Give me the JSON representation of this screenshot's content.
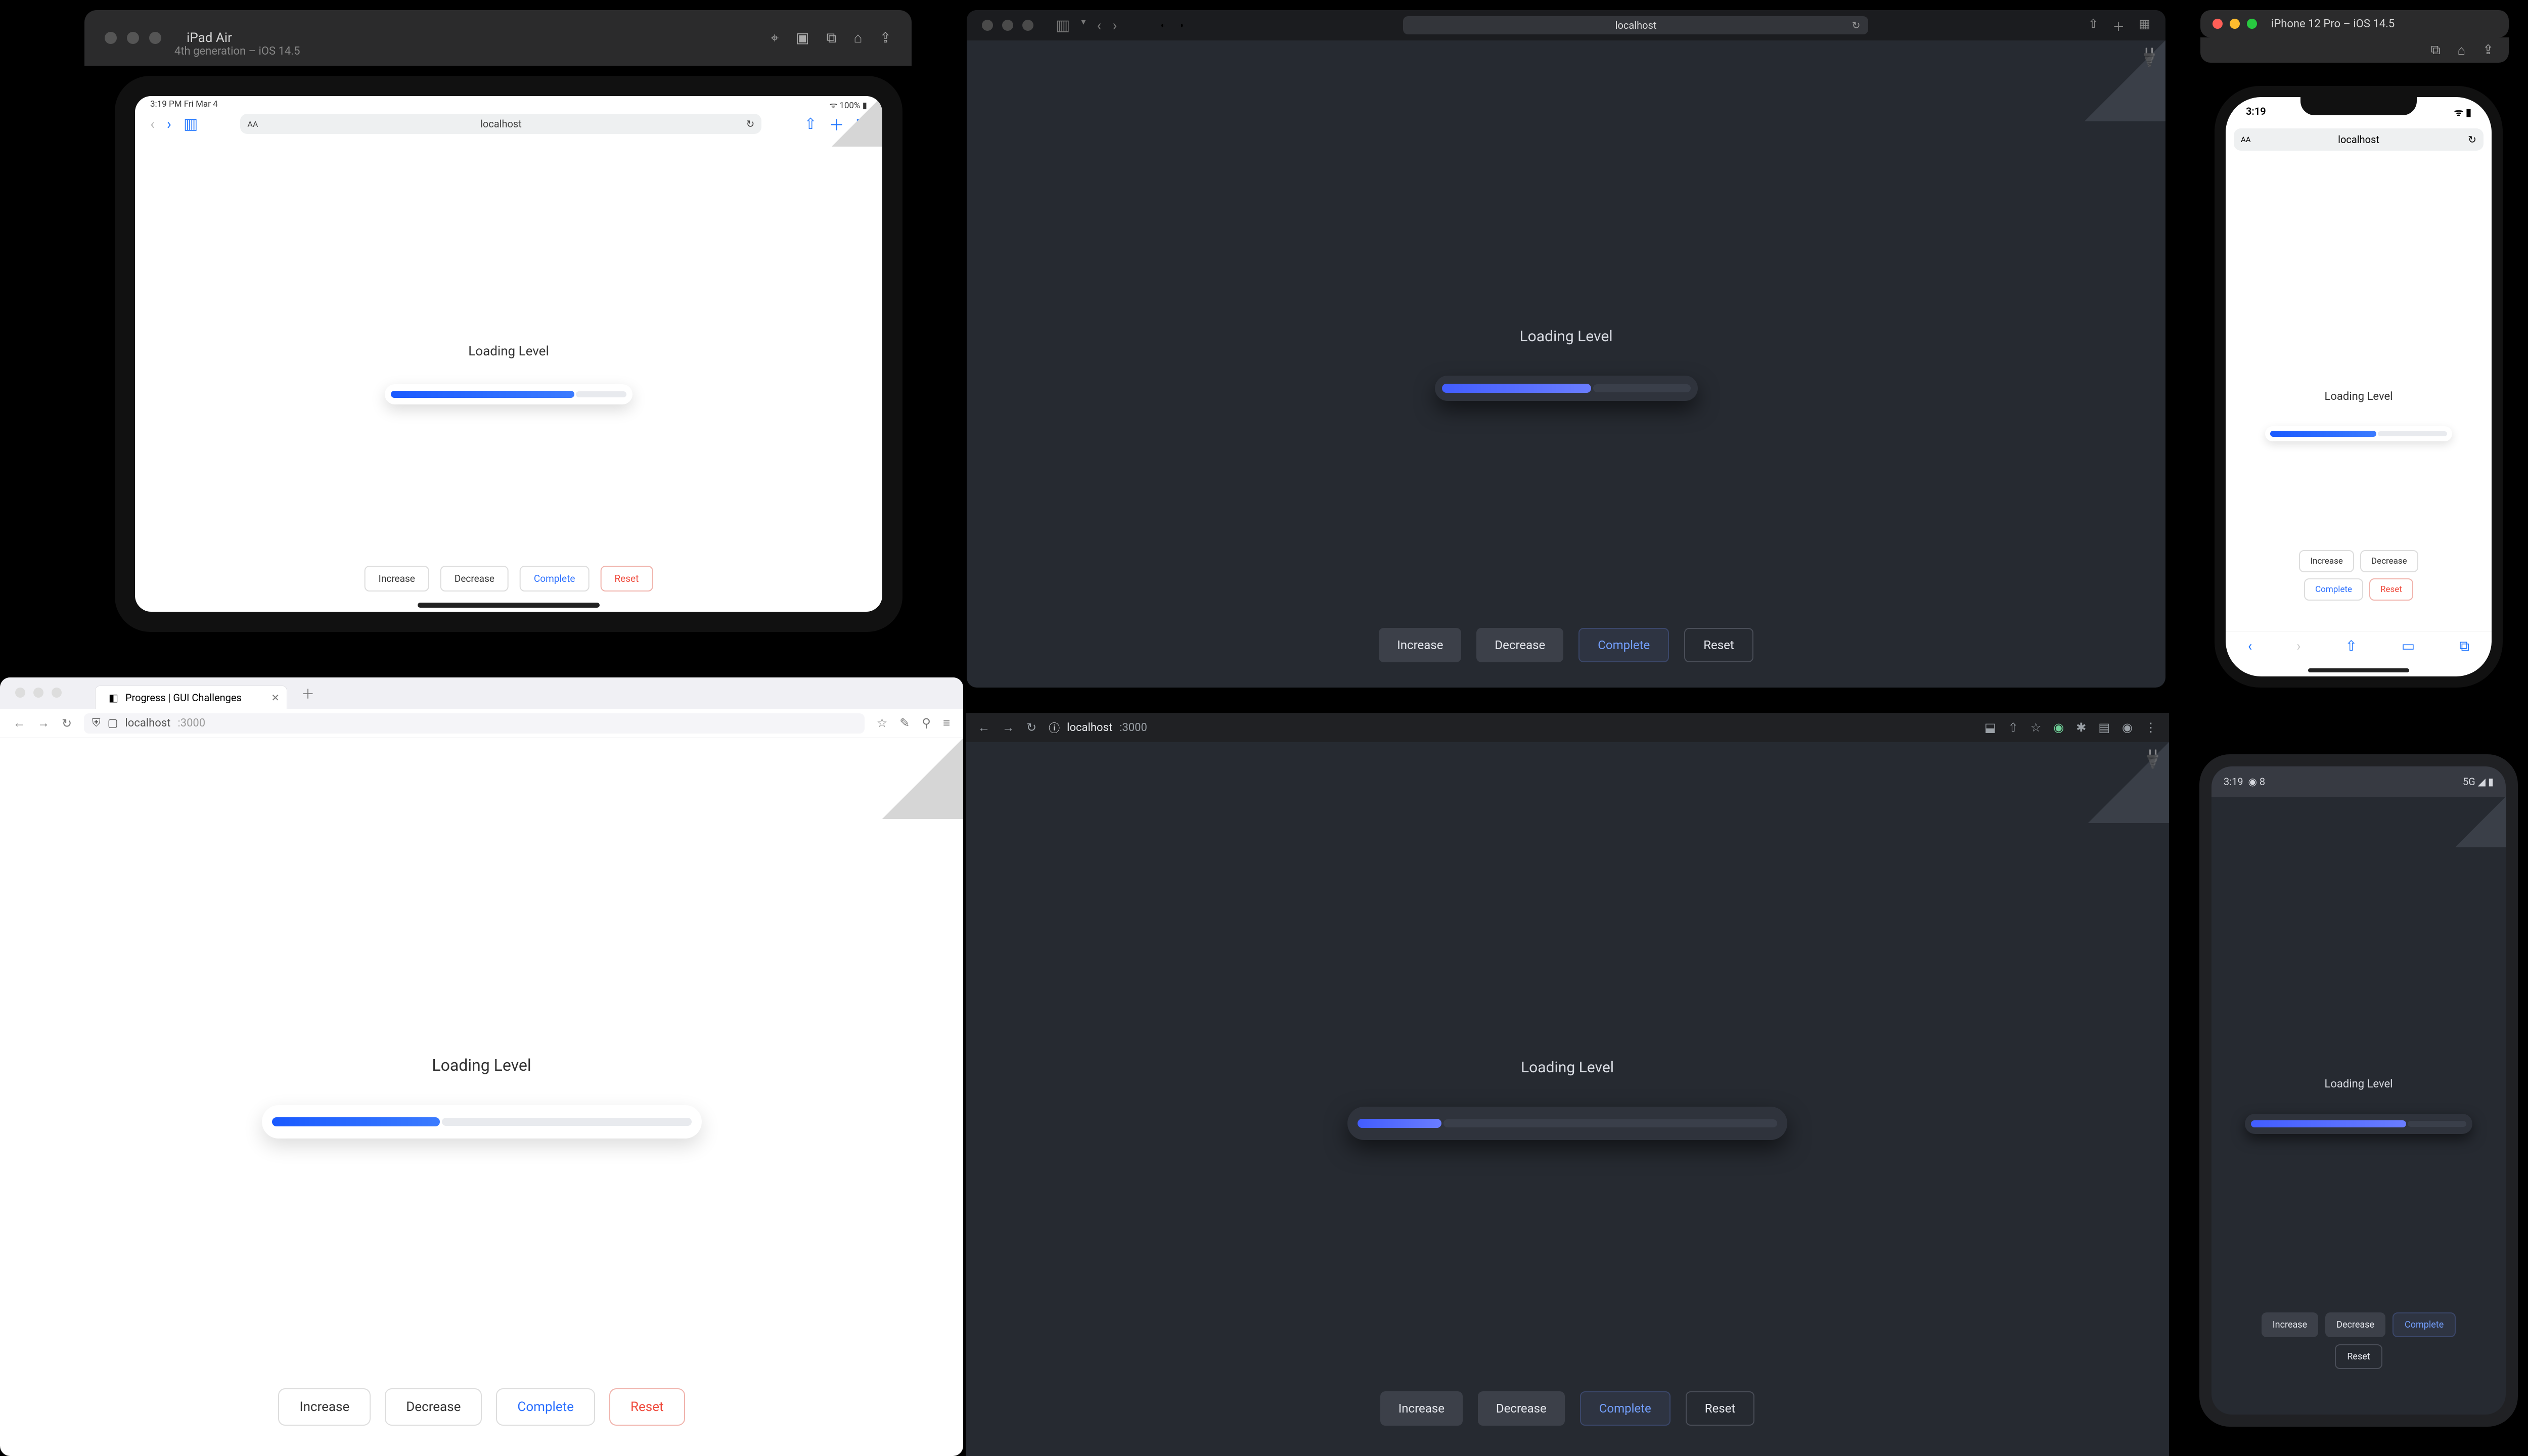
{
  "common": {
    "loading_label": "Loading Level",
    "buttons": {
      "increase": "Increase",
      "decrease": "Decrease",
      "complete": "Complete",
      "reset": "Reset"
    }
  },
  "ipad_sim": {
    "device_name": "iPad Air",
    "device_sub": "4th generation – iOS 14.5",
    "status_left": "3:19 PM   Fri Mar 4",
    "status_right": "ᯤ 100% ▮",
    "url": "localhost",
    "url_aa": "AA",
    "progress_pct": 78
  },
  "safari": {
    "url": "localhost",
    "progress_pct": 60
  },
  "iphone_sim": {
    "title": "iPhone 12 Pro – iOS 14.5",
    "status_time": "3:19",
    "status_right": "ᯤ ▮",
    "url": "localhost",
    "url_aa": "AA",
    "progress_pct": 60
  },
  "firefox": {
    "tab_title": "Progress | GUI Challenges",
    "addr_host": "localhost",
    "addr_port": ":3000",
    "progress_pct": 40
  },
  "chrome": {
    "addr_host": "localhost",
    "addr_port": ":3000",
    "progress_pct": 20
  },
  "android": {
    "status_time": "3:19",
    "status_debug": "◉ 8",
    "status_right": "5G ◢ ▮",
    "progress_pct": 72
  }
}
